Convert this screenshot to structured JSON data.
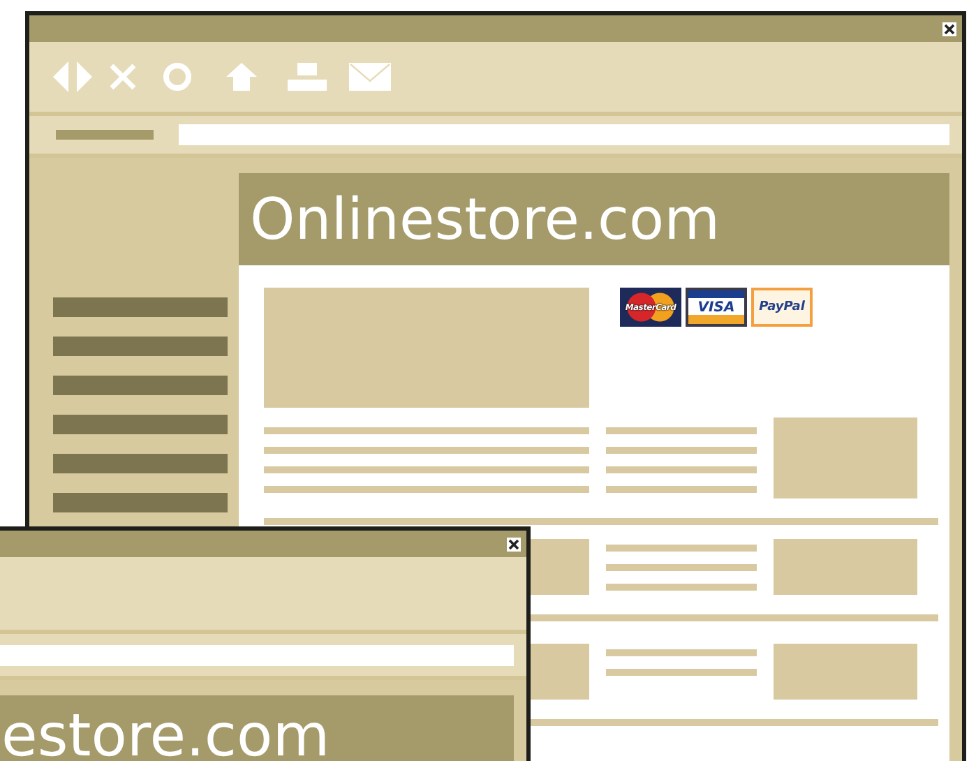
{
  "main_window": {
    "site_title": "Onlinestore.com",
    "payment_logos": [
      {
        "kind": "mastercard",
        "label": "MasterCard"
      },
      {
        "kind": "visa",
        "label": "VISA"
      },
      {
        "kind": "paypal",
        "label": "PayPal"
      }
    ]
  },
  "front_window": {
    "site_title": "estore.com"
  }
}
